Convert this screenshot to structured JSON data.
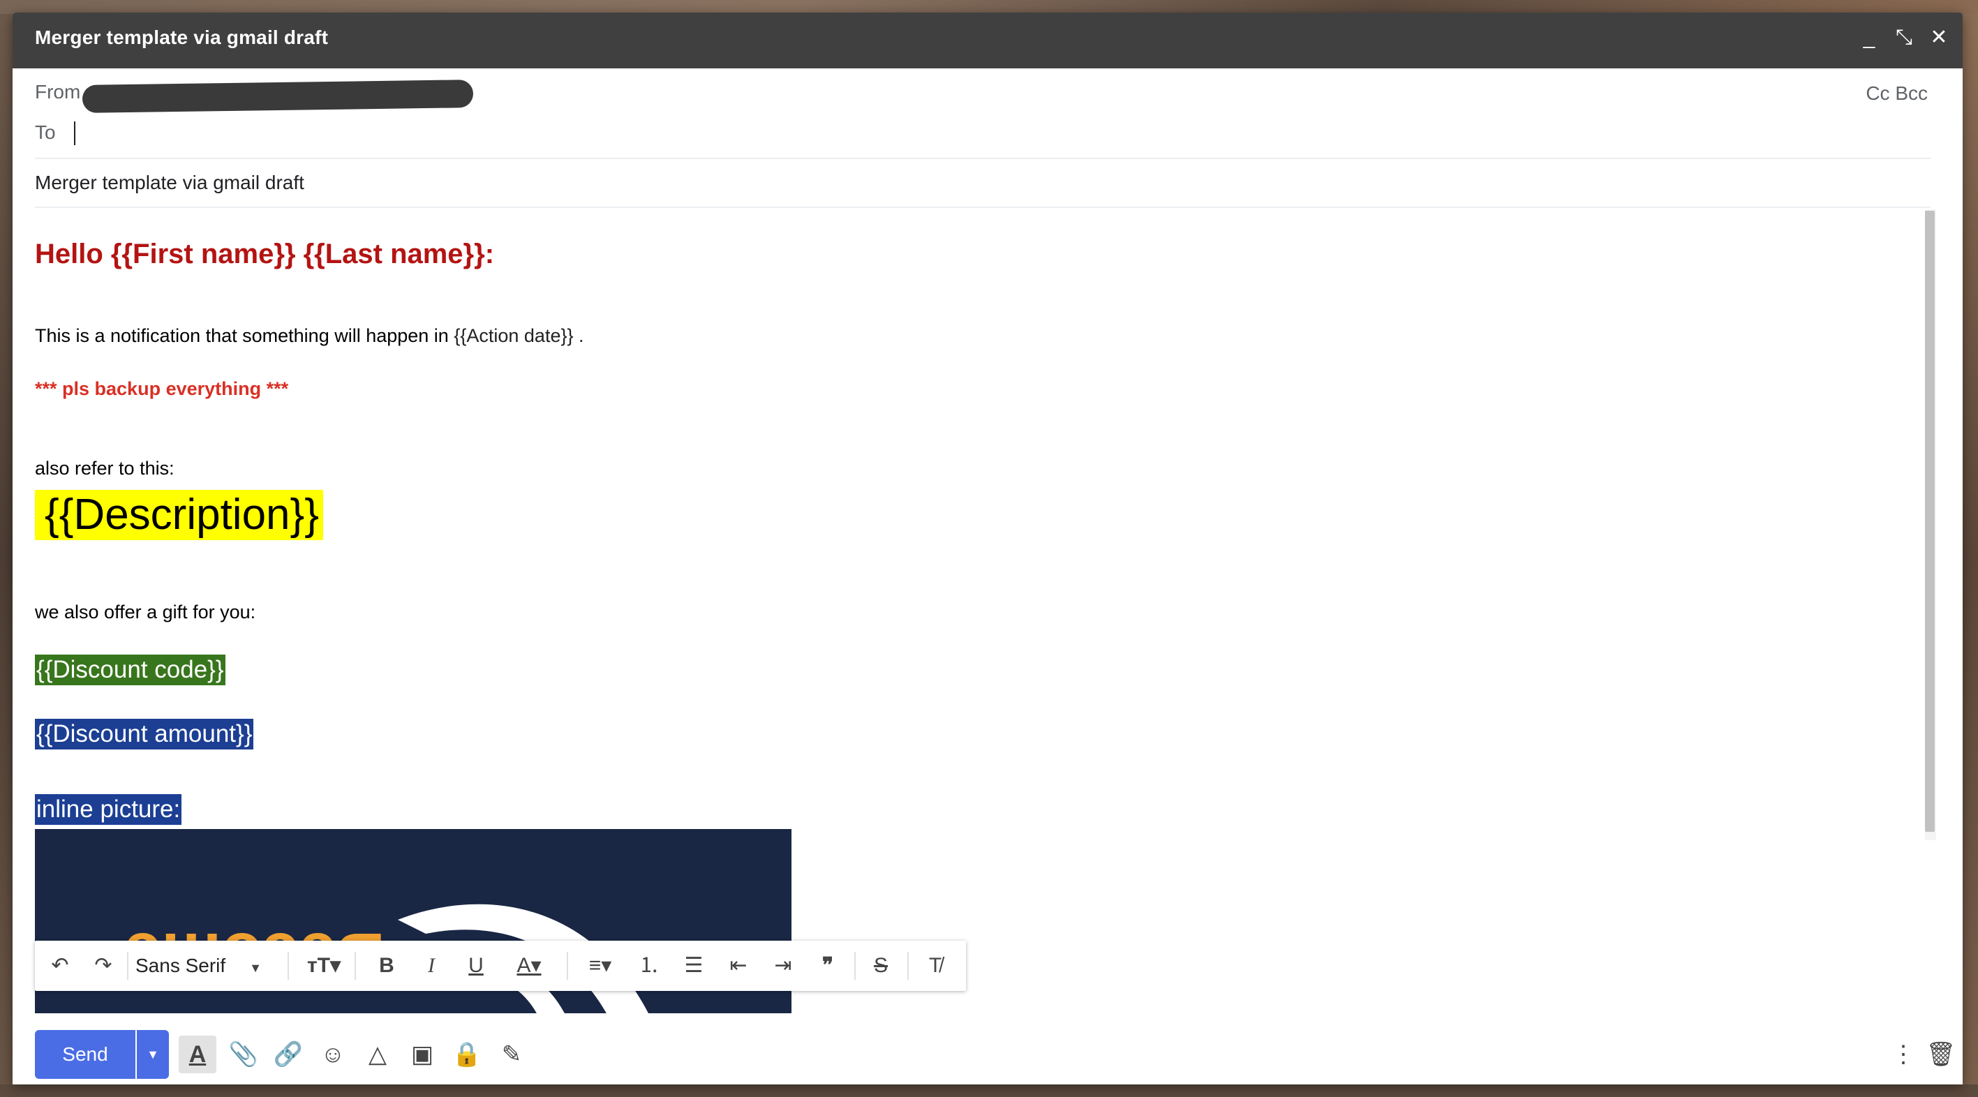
{
  "window": {
    "title": "Merger template via gmail draft",
    "minimize": "_",
    "exit_fullscreen": "⤡",
    "close": "✕"
  },
  "header": {
    "from_label": "From",
    "cc_bcc": "Cc Bcc",
    "to_label": "To",
    "to_value": "",
    "subject": "Merger template via gmail draft"
  },
  "body": {
    "greeting": "Hello {{First name}} {{Last name}}:",
    "line1_text": "This is a notification that something will happen in ",
    "line1_placeholder": "{{Action date}} .",
    "warning": "*** pls backup everything ***",
    "refer": "also refer to this:",
    "description": "{{Description}}",
    "gift": "we also offer a gift for you:",
    "discount_code": "{{Discount code}}",
    "discount_amount": "{{Discount amount}}",
    "inline_picture": "inline picture:",
    "picture_text": "Become"
  },
  "formatting": {
    "font": "Sans Serif"
  },
  "footer": {
    "send": "Send"
  },
  "colors": {
    "titlebar": "#404040",
    "send": "#4a6de5",
    "greeting": "#b31412",
    "warning": "#d93025",
    "highlight_yellow": "#ffff00",
    "highlight_green": "#38761d",
    "highlight_blue": "#1c3f94"
  }
}
